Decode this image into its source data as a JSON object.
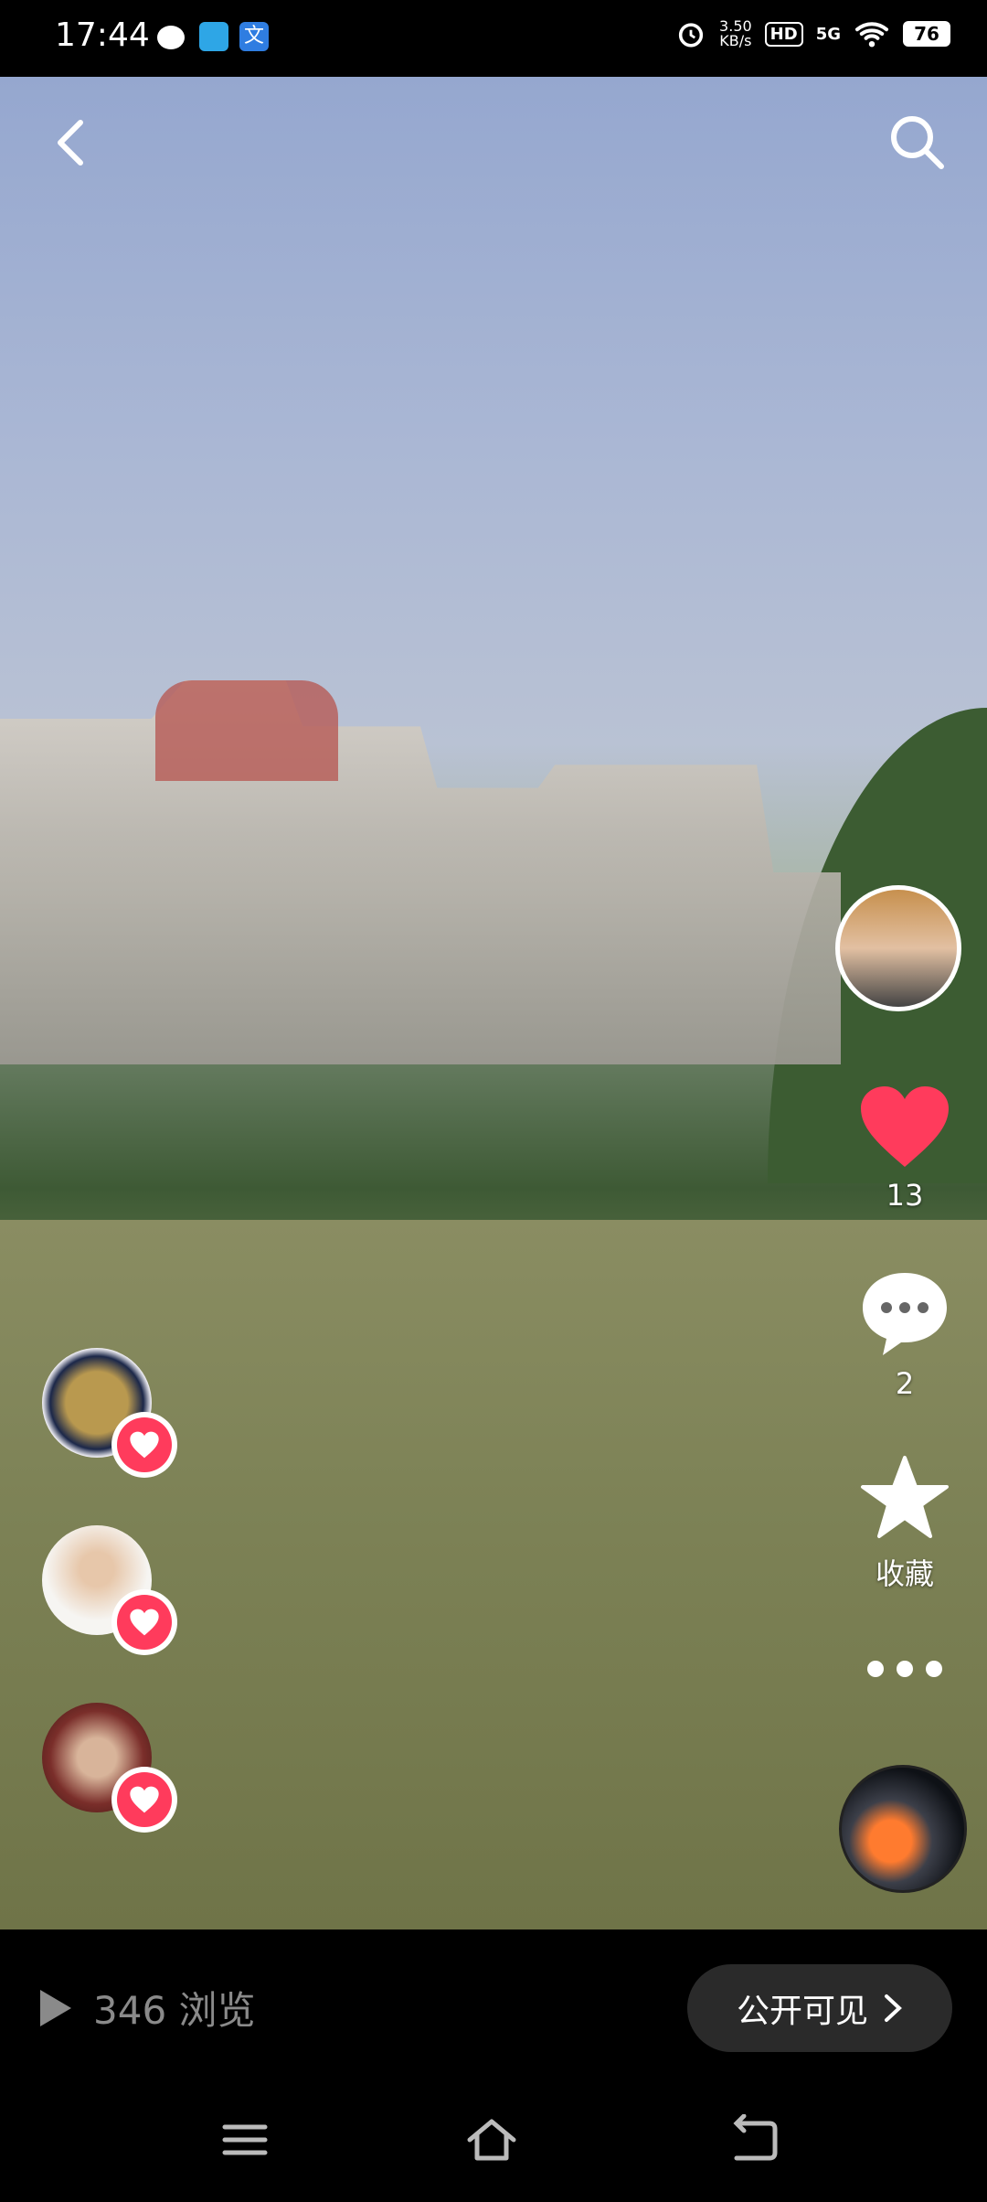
{
  "status_bar": {
    "time": "17:44",
    "network_speed": "3.50\nKB/s",
    "hd": "HD",
    "signal": "5G",
    "battery": "76"
  },
  "post": {
    "likes": "13",
    "comments": "2",
    "collect_label": "收藏"
  },
  "footer": {
    "views": "346 浏览",
    "visibility_label": "公开可见"
  },
  "colors": {
    "like": "#ff3b5c",
    "button_bg": "#2a2a2a",
    "muted_text": "#8a8a8a"
  }
}
